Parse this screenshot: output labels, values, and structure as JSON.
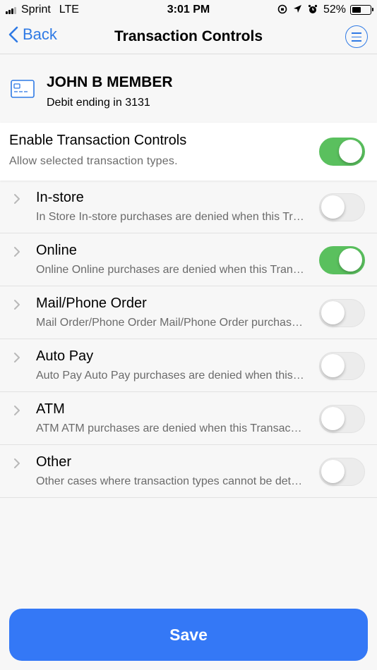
{
  "status_bar": {
    "carrier": "Sprint",
    "network": "LTE",
    "time": "3:01 PM",
    "battery": "52%",
    "battery_level": 0.52
  },
  "nav": {
    "back_label": "Back",
    "title": "Transaction Controls"
  },
  "card": {
    "name": "JOHN B MEMBER",
    "subtitle": "Debit ending in 3131"
  },
  "enable": {
    "title": "Enable Transaction Controls",
    "description": "Allow selected transaction types.",
    "on": true
  },
  "controls": [
    {
      "title": "In-store",
      "description": "In Store In-store purchases are denied when this Transaction Control is turned on.",
      "on": false
    },
    {
      "title": "Online",
      "description": "Online Online purchases are denied when this Transaction Control is turned on.",
      "on": true
    },
    {
      "title": "Mail/Phone Order",
      "description": "Mail Order/Phone Order Mail/Phone Order purchases are denied when this Transaction Control is turned on.",
      "on": false
    },
    {
      "title": "Auto Pay",
      "description": "Auto Pay Auto Pay purchases are denied when this Transaction Control is turned on.",
      "on": false
    },
    {
      "title": "ATM",
      "description": "ATM ATM purchases are denied when this Transaction Control is turned on.",
      "on": false
    },
    {
      "title": "Other",
      "description": "Other cases where transaction types cannot be determined.",
      "on": false
    }
  ],
  "save_label": "Save",
  "colors": {
    "accent": "#3478f6",
    "toggle_on": "#5ac05e"
  }
}
